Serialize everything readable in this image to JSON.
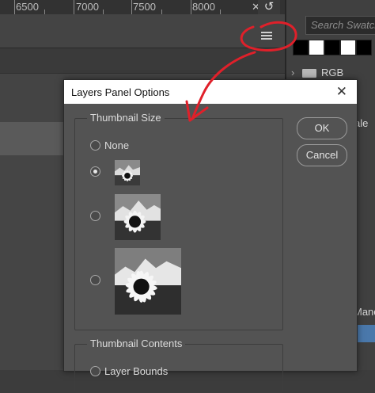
{
  "ruler": {
    "labels": [
      "6500",
      "7000",
      "7500",
      "8000"
    ]
  },
  "panel_menu": {
    "icon": "hamburger-menu-icon"
  },
  "swatches": {
    "search_placeholder": "Search Swatch",
    "colors": [
      "#000000",
      "#ffffff",
      "#000000",
      "#ffffff",
      "#000000"
    ],
    "folder_label": "RGB"
  },
  "right_panel": {
    "partial_text_1": "ale",
    "partial_text_2": "Manci"
  },
  "dialog": {
    "title": "Layers Panel Options",
    "close_symbol": "✕",
    "ok_label": "OK",
    "cancel_label": "Cancel",
    "thumbnail_size": {
      "legend": "Thumbnail Size",
      "none_label": "None",
      "selected": "small"
    },
    "thumbnail_contents": {
      "legend": "Thumbnail Contents",
      "option_label": "Layer Bounds"
    }
  },
  "annotation": {
    "color": "#e0202a"
  }
}
